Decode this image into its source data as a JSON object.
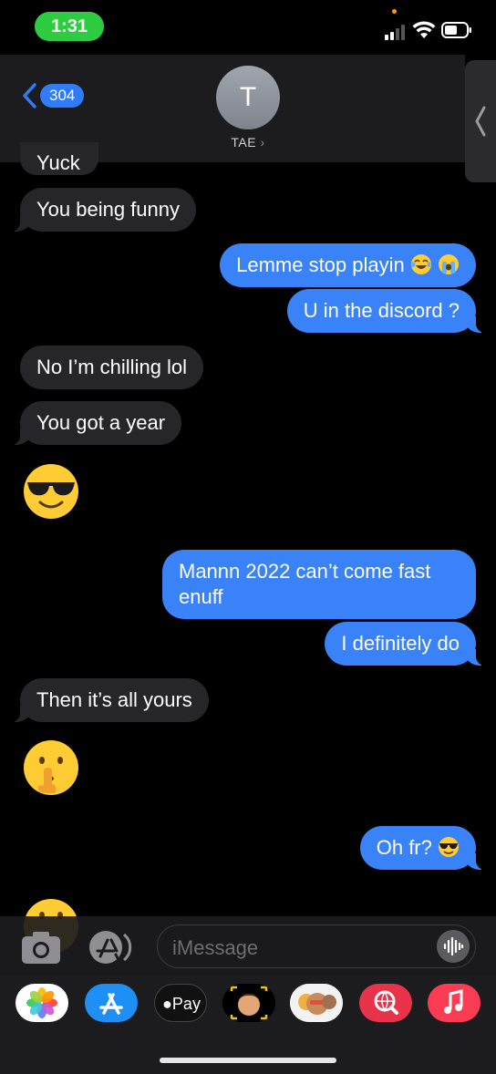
{
  "status_bar": {
    "time": "1:31"
  },
  "header": {
    "back_count": "304",
    "avatar_initial": "T",
    "contact_name": "TAE"
  },
  "messages": [
    {
      "from": "them",
      "text": "Yuck"
    },
    {
      "from": "them",
      "text": "You being funny"
    },
    {
      "from": "me",
      "text": "Lemme stop playin",
      "emojis": [
        "face-with-tears-of-joy",
        "loudly-crying-face"
      ]
    },
    {
      "from": "me",
      "text": "U in the discord ?"
    },
    {
      "from": "them",
      "text": "No I’m chilling lol"
    },
    {
      "from": "them",
      "text": "You got a year"
    },
    {
      "from": "them",
      "emoji": "smiling-face-with-sunglasses"
    },
    {
      "from": "me",
      "text_line1": "Mannn 2022 can’t come fast",
      "text_line2": "enuff"
    },
    {
      "from": "me",
      "text": "I definitely do"
    },
    {
      "from": "them",
      "text": "Then it’s all yours"
    },
    {
      "from": "them",
      "emoji": "shushing-face"
    },
    {
      "from": "me",
      "text": "Oh fr?",
      "emojis": [
        "smiling-face-with-sunglasses"
      ]
    },
    {
      "from": "them",
      "emoji": "smiling-face-partial"
    }
  ],
  "compose": {
    "placeholder": "iMessage",
    "camera_icon": "camera-icon",
    "apps_icon": "app-store-icon",
    "voice_icon": "waveform-icon"
  },
  "app_drawer": [
    {
      "name": "photos",
      "label": ""
    },
    {
      "name": "app-store",
      "label": ""
    },
    {
      "name": "apple-pay",
      "label": "Pay"
    },
    {
      "name": "memoji",
      "label": ""
    },
    {
      "name": "memoji-stickers",
      "label": ""
    },
    {
      "name": "image-search",
      "label": ""
    },
    {
      "name": "music",
      "label": ""
    }
  ],
  "colors": {
    "outgoing_bubble": "#3a82f7",
    "incoming_bubble": "#262629",
    "time_pill": "#2ecc40",
    "back_badge": "#2f7cf6"
  }
}
